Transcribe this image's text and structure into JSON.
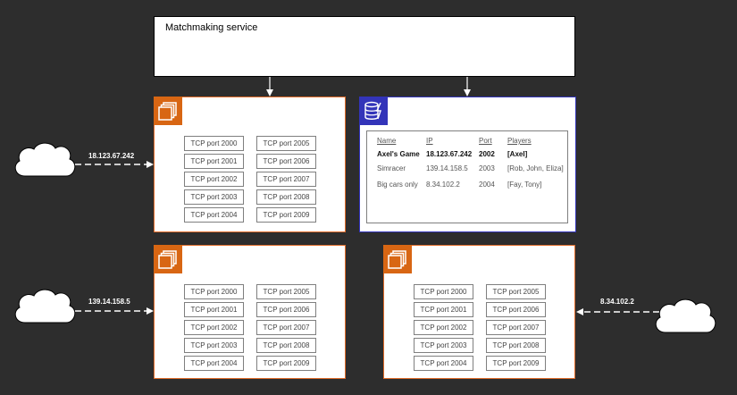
{
  "matchmaking": {
    "title": "Matchmaking service"
  },
  "servers": [
    {
      "ip": "18.123.67.242",
      "ports": [
        "TCP port 2000",
        "TCP port 2001",
        "TCP port 2002",
        "TCP port 2003",
        "TCP port 2004",
        "TCP port 2005",
        "TCP port 2006",
        "TCP port 2007",
        "TCP port 2008",
        "TCP port 2009"
      ]
    },
    {
      "ip": "139.14.158.5",
      "ports": [
        "TCP port 2000",
        "TCP port 2001",
        "TCP port 2002",
        "TCP port 2003",
        "TCP port 2004",
        "TCP port 2005",
        "TCP port 2006",
        "TCP port 2007",
        "TCP port 2008",
        "TCP port 2009"
      ]
    },
    {
      "ip": "8.34.102.2",
      "ports": [
        "TCP port 2000",
        "TCP port 2001",
        "TCP port 2002",
        "TCP port 2003",
        "TCP port 2004",
        "TCP port 2005",
        "TCP port 2006",
        "TCP port 2007",
        "TCP port 2008",
        "TCP port 2009"
      ]
    }
  ],
  "database": {
    "headers": {
      "name": "Name",
      "ip": "IP",
      "port": "Port",
      "players": "Players"
    },
    "rows": [
      {
        "name": "Axel's Game",
        "ip": "18.123.67.242",
        "port": "2002",
        "players": "[Axel]"
      },
      {
        "name": "Simracer",
        "ip": "139.14.158.5",
        "port": "2003",
        "players": "[Rob, John, Eliza]"
      },
      {
        "name": "Big cars only",
        "ip": "8.34.102.2",
        "port": "2004",
        "players": "[Fay, Tony]"
      }
    ]
  },
  "colors": {
    "background": "#2d2d2d",
    "ec2": "#d86613",
    "ec2_border": "#e06c2a",
    "database": "#3334b9"
  },
  "icons": {
    "server": "ec2-instances-icon",
    "database": "dynamodb-icon",
    "client": "cloud-icon"
  }
}
